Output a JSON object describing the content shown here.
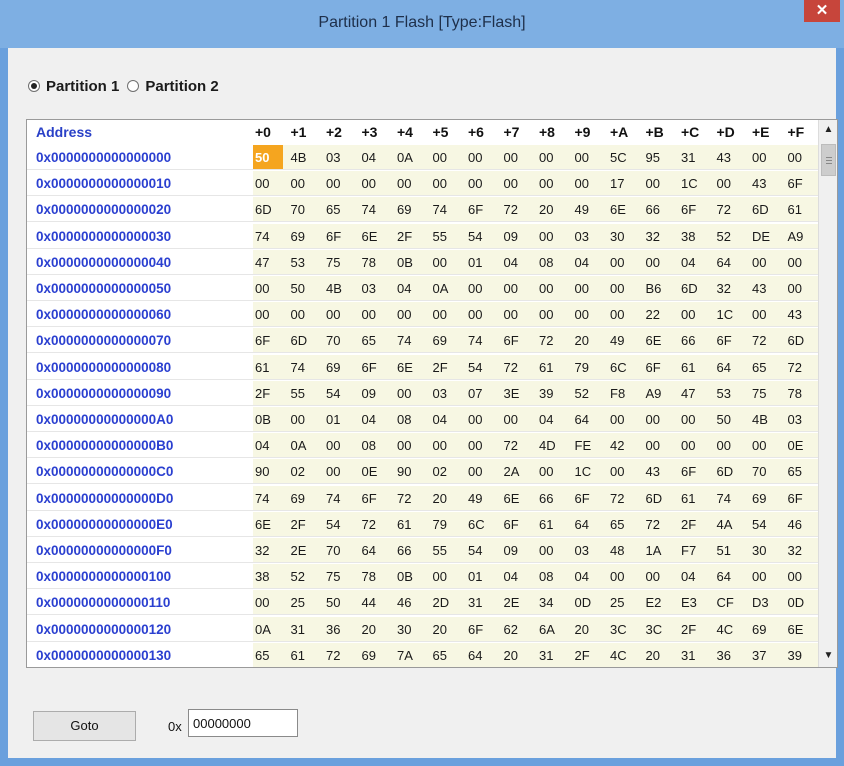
{
  "window": {
    "title": "Partition 1 Flash [Type:Flash]",
    "close_glyph": "✕"
  },
  "partitions": [
    {
      "label": "Partition 1",
      "selected": true
    },
    {
      "label": "Partition 2",
      "selected": false
    }
  ],
  "grid": {
    "address_header": "Address",
    "column_headers": [
      "+0",
      "+1",
      "+2",
      "+3",
      "+4",
      "+5",
      "+6",
      "+7",
      "+8",
      "+9",
      "+A",
      "+B",
      "+C",
      "+D",
      "+E",
      "+F"
    ],
    "selected_cell": "0x0000000000000000 +0",
    "rows": [
      {
        "address": "0x0000000000000000",
        "bytes": [
          "50",
          "4B",
          "03",
          "04",
          "0A",
          "00",
          "00",
          "00",
          "00",
          "00",
          "5C",
          "95",
          "31",
          "43",
          "00",
          "00"
        ]
      },
      {
        "address": "0x0000000000000010",
        "bytes": [
          "00",
          "00",
          "00",
          "00",
          "00",
          "00",
          "00",
          "00",
          "00",
          "00",
          "17",
          "00",
          "1C",
          "00",
          "43",
          "6F"
        ]
      },
      {
        "address": "0x0000000000000020",
        "bytes": [
          "6D",
          "70",
          "65",
          "74",
          "69",
          "74",
          "6F",
          "72",
          "20",
          "49",
          "6E",
          "66",
          "6F",
          "72",
          "6D",
          "61"
        ]
      },
      {
        "address": "0x0000000000000030",
        "bytes": [
          "74",
          "69",
          "6F",
          "6E",
          "2F",
          "55",
          "54",
          "09",
          "00",
          "03",
          "30",
          "32",
          "38",
          "52",
          "DE",
          "A9"
        ]
      },
      {
        "address": "0x0000000000000040",
        "bytes": [
          "47",
          "53",
          "75",
          "78",
          "0B",
          "00",
          "01",
          "04",
          "08",
          "04",
          "00",
          "00",
          "04",
          "64",
          "00",
          "00"
        ]
      },
      {
        "address": "0x0000000000000050",
        "bytes": [
          "00",
          "50",
          "4B",
          "03",
          "04",
          "0A",
          "00",
          "00",
          "00",
          "00",
          "00",
          "B6",
          "6D",
          "32",
          "43",
          "00"
        ]
      },
      {
        "address": "0x0000000000000060",
        "bytes": [
          "00",
          "00",
          "00",
          "00",
          "00",
          "00",
          "00",
          "00",
          "00",
          "00",
          "00",
          "22",
          "00",
          "1C",
          "00",
          "43"
        ]
      },
      {
        "address": "0x0000000000000070",
        "bytes": [
          "6F",
          "6D",
          "70",
          "65",
          "74",
          "69",
          "74",
          "6F",
          "72",
          "20",
          "49",
          "6E",
          "66",
          "6F",
          "72",
          "6D"
        ]
      },
      {
        "address": "0x0000000000000080",
        "bytes": [
          "61",
          "74",
          "69",
          "6F",
          "6E",
          "2F",
          "54",
          "72",
          "61",
          "79",
          "6C",
          "6F",
          "61",
          "64",
          "65",
          "72"
        ]
      },
      {
        "address": "0x0000000000000090",
        "bytes": [
          "2F",
          "55",
          "54",
          "09",
          "00",
          "03",
          "07",
          "3E",
          "39",
          "52",
          "F8",
          "A9",
          "47",
          "53",
          "75",
          "78"
        ]
      },
      {
        "address": "0x00000000000000A0",
        "bytes": [
          "0B",
          "00",
          "01",
          "04",
          "08",
          "04",
          "00",
          "00",
          "04",
          "64",
          "00",
          "00",
          "00",
          "50",
          "4B",
          "03"
        ]
      },
      {
        "address": "0x00000000000000B0",
        "bytes": [
          "04",
          "0A",
          "00",
          "08",
          "00",
          "00",
          "00",
          "72",
          "4D",
          "FE",
          "42",
          "00",
          "00",
          "00",
          "00",
          "0E"
        ]
      },
      {
        "address": "0x00000000000000C0",
        "bytes": [
          "90",
          "02",
          "00",
          "0E",
          "90",
          "02",
          "00",
          "2A",
          "00",
          "1C",
          "00",
          "43",
          "6F",
          "6D",
          "70",
          "65"
        ]
      },
      {
        "address": "0x00000000000000D0",
        "bytes": [
          "74",
          "69",
          "74",
          "6F",
          "72",
          "20",
          "49",
          "6E",
          "66",
          "6F",
          "72",
          "6D",
          "61",
          "74",
          "69",
          "6F"
        ]
      },
      {
        "address": "0x00000000000000E0",
        "bytes": [
          "6E",
          "2F",
          "54",
          "72",
          "61",
          "79",
          "6C",
          "6F",
          "61",
          "64",
          "65",
          "72",
          "2F",
          "4A",
          "54",
          "46"
        ]
      },
      {
        "address": "0x00000000000000F0",
        "bytes": [
          "32",
          "2E",
          "70",
          "64",
          "66",
          "55",
          "54",
          "09",
          "00",
          "03",
          "48",
          "1A",
          "F7",
          "51",
          "30",
          "32"
        ]
      },
      {
        "address": "0x0000000000000100",
        "bytes": [
          "38",
          "52",
          "75",
          "78",
          "0B",
          "00",
          "01",
          "04",
          "08",
          "04",
          "00",
          "00",
          "04",
          "64",
          "00",
          "00"
        ]
      },
      {
        "address": "0x0000000000000110",
        "bytes": [
          "00",
          "25",
          "50",
          "44",
          "46",
          "2D",
          "31",
          "2E",
          "34",
          "0D",
          "25",
          "E2",
          "E3",
          "CF",
          "D3",
          "0D"
        ]
      },
      {
        "address": "0x0000000000000120",
        "bytes": [
          "0A",
          "31",
          "36",
          "20",
          "30",
          "20",
          "6F",
          "62",
          "6A",
          "20",
          "3C",
          "3C",
          "2F",
          "4C",
          "69",
          "6E"
        ]
      },
      {
        "address": "0x0000000000000130",
        "bytes": [
          "65",
          "61",
          "72",
          "69",
          "7A",
          "65",
          "64",
          "20",
          "31",
          "2F",
          "4C",
          "20",
          "31",
          "36",
          "37",
          "39"
        ]
      }
    ]
  },
  "scrollbar": {
    "up_glyph": "▲",
    "down_glyph": "▼"
  },
  "goto": {
    "button_label": "Goto",
    "prefix": "0x",
    "value": "00000000"
  },
  "colors": {
    "address_text": "#2a3fd0",
    "hex_band": "#f7f7e3",
    "selection": "#f5a51f",
    "title_bar": "#7eafe3",
    "close_button": "#c7453b"
  }
}
